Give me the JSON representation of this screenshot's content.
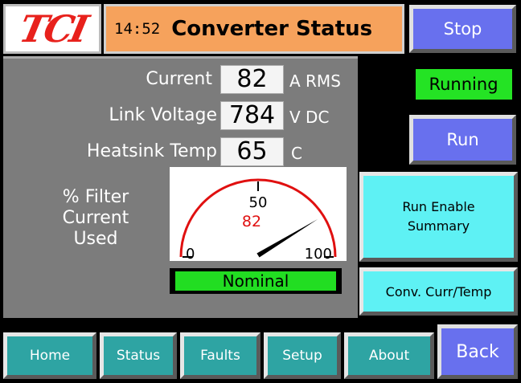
{
  "header": {
    "logo": "TCI",
    "time": "14:52",
    "title": "Converter Status"
  },
  "readings": [
    {
      "label": "Current",
      "value": "82",
      "unit": "A RMS"
    },
    {
      "label": "Link Voltage",
      "value": "784",
      "unit": "V DC"
    },
    {
      "label": "Heatsink Temp",
      "value": "65",
      "unit": "C"
    }
  ],
  "gauge": {
    "label_line1": "% Filter",
    "label_line2": "Current",
    "label_line3": "Used",
    "min_label": "0",
    "mid_label": "50",
    "max_label": "100",
    "min": 0,
    "max": 100,
    "value": 82,
    "value_label": "82",
    "status": "Nominal",
    "arc_color": "#e01010",
    "value_color": "#e01010",
    "status_color": "#22dd22"
  },
  "right": {
    "stop_label": "Stop",
    "running_label": "Running",
    "run_label": "Run",
    "run_enable_line1": "Run Enable",
    "run_enable_line2": "Summary",
    "conv_label": "Conv. Curr/Temp",
    "back_label": "Back"
  },
  "nav": {
    "home": "Home",
    "status": "Status",
    "faults": "Faults",
    "setup": "Setup",
    "about": "About"
  },
  "colors": {
    "title_bg": "#f6a25c",
    "panel_bg": "#7c7c7c",
    "button_blue": "#6870ee",
    "button_cyan": "#5ef1f4",
    "nav_teal": "#2ea4a3",
    "running_green": "#24e324"
  }
}
